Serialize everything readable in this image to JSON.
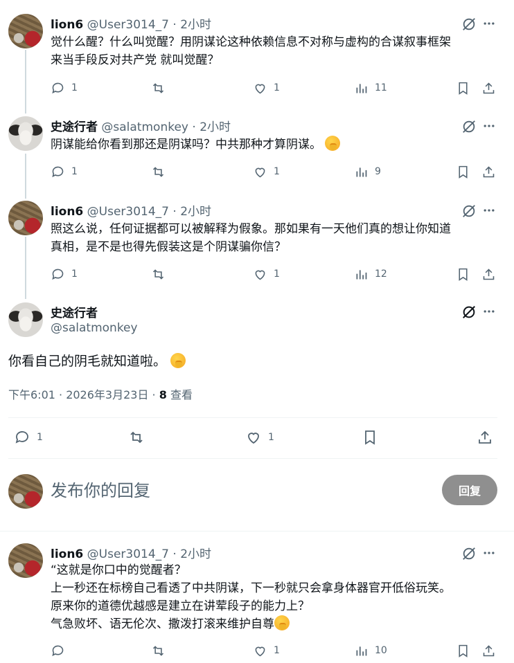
{
  "posts": [
    {
      "name": "lion6",
      "handle": "@User3014_7",
      "time": "2小时",
      "lines": [
        "觉什么醒？什么叫觉醒？用阴谋论这种依赖信息不对称与虚构的合谋叙事框架",
        "来当手段反对共产党 就叫觉醒？"
      ],
      "replies": "1",
      "retweets": "",
      "likes": "1",
      "views": "11"
    },
    {
      "name": "史途行者",
      "handle": "@salatmonkey",
      "time": "2小时",
      "lines": [
        "阴谋能给你看到那还是阴谋吗？中共那种才算阴谋。"
      ],
      "replies": "1",
      "retweets": "",
      "likes": "1",
      "views": "9"
    },
    {
      "name": "lion6",
      "handle": "@User3014_7",
      "time": "2小时",
      "lines": [
        "照这么说，任何证据都可以被解释为假象。那如果有一天他们真的想让你知道",
        "真相，是不是也得先假装这是个阴谋骗你信？"
      ],
      "replies": "1",
      "retweets": "",
      "likes": "1",
      "views": "12"
    }
  ],
  "main_post": {
    "name": "史途行者",
    "handle": "@salatmonkey",
    "text": "你看自己的阴毛就知道啦。",
    "timestamp": "下午6:01 · 2026年3月23日 · ",
    "view_count": "8",
    "view_label": " 查看",
    "replies": "1",
    "likes": "1"
  },
  "reply_composer": {
    "placeholder": "发布你的回复",
    "button_label": "回复"
  },
  "last_reply": {
    "name": "lion6",
    "handle": "@User3014_7",
    "time": "2小时",
    "lines": [
      "“这就是你口中的觉醒者？",
      "上一秒还在标榜自己看透了中共阴谋，下一秒就只会拿身体器官开低俗玩笑。",
      "原来你的道德优越感是建立在讲荤段子的能力上？",
      "气急败坏、语无伦次、撒泼打滚来维护自尊"
    ],
    "replies": "",
    "likes": "1",
    "views": "10"
  },
  "separator": " · "
}
